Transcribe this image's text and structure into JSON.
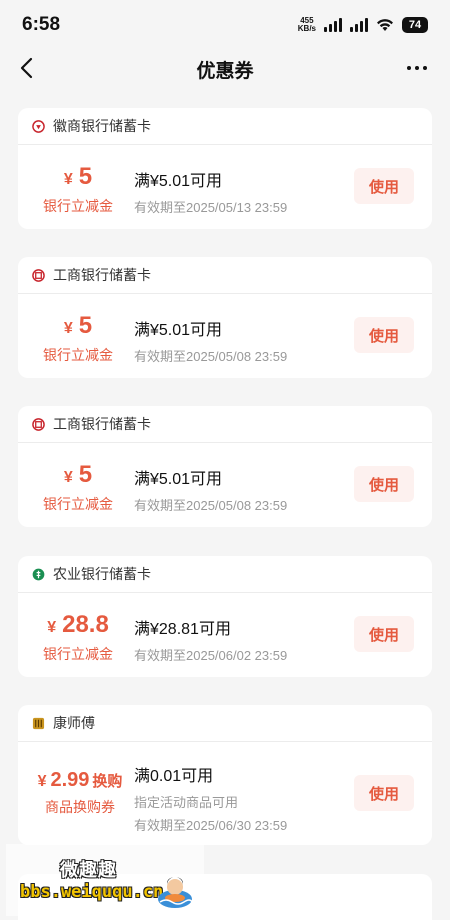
{
  "status_bar": {
    "time": "6:58",
    "net_speed_value": "455",
    "net_speed_unit": "KB/s",
    "battery": "74"
  },
  "header": {
    "title": "优惠券",
    "back_icon": "chevron-left-icon",
    "more_icon": "ellipsis-icon"
  },
  "coupons": [
    {
      "bank": "徽商银行储蓄卡",
      "currency": "¥",
      "amount": "5",
      "amount_suffix": "",
      "subtitle": "银行立减金",
      "condition": "满¥5.01可用",
      "meta": [
        "有效期至2025/05/13 23:59"
      ],
      "button": "使用"
    },
    {
      "bank": "工商银行储蓄卡",
      "currency": "¥",
      "amount": "5",
      "amount_suffix": "",
      "subtitle": "银行立减金",
      "condition": "满¥5.01可用",
      "meta": [
        "有效期至2025/05/08 23:59"
      ],
      "button": "使用"
    },
    {
      "bank": "工商银行储蓄卡",
      "currency": "¥",
      "amount": "5",
      "amount_suffix": "",
      "subtitle": "银行立减金",
      "condition": "满¥5.01可用",
      "meta": [
        "有效期至2025/05/08 23:59"
      ],
      "button": "使用"
    },
    {
      "bank": "农业银行储蓄卡",
      "currency": "¥",
      "amount": "28.8",
      "amount_suffix": "",
      "subtitle": "银行立减金",
      "condition": "满¥28.81可用",
      "meta": [
        "有效期至2025/06/02 23:59"
      ],
      "button": "使用"
    },
    {
      "bank": "康师傅",
      "currency": "¥",
      "amount": "2.99",
      "amount_suffix": "换购",
      "subtitle": "商品换购券",
      "condition": "满0.01可用",
      "meta": [
        "指定活动商品可用",
        "有效期至2025/06/30 23:59"
      ],
      "button": "使用"
    }
  ],
  "watermark": {
    "line1": "微趣趣",
    "line2": "bbs.weiququ.cn"
  },
  "colors": {
    "accent": "#e55a3f",
    "accent_bg": "#fdf1ef",
    "page_bg": "#f5f5f5",
    "hsbank": "#c8262e",
    "icbc": "#c8262e",
    "abc": "#1a8f52",
    "ksf": "#c9941e"
  }
}
